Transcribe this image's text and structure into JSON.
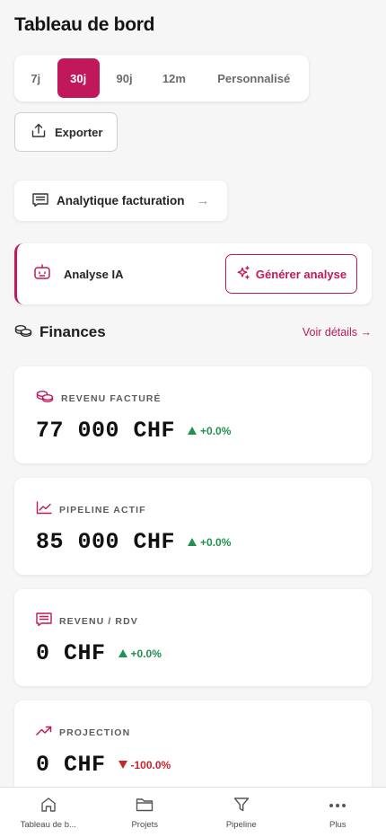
{
  "page": {
    "title": "Tableau de bord"
  },
  "range_tabs": {
    "items": [
      "7j",
      "30j",
      "90j",
      "12m",
      "Personnalisé"
    ],
    "selected": "30j"
  },
  "export": {
    "label": "Exporter"
  },
  "billing": {
    "label": "Analytique facturation",
    "arrow": "→"
  },
  "ai": {
    "label": "Analyse IA",
    "button": "Générer analyse"
  },
  "finances": {
    "title": "Finances",
    "link": "Voir détails →"
  },
  "kpis": [
    {
      "label": "REVENU FACTURÉ",
      "value": "77 000 CHF",
      "delta": "+0.0%",
      "trend": "up",
      "icon": "coins-icon"
    },
    {
      "label": "PIPELINE ACTIF",
      "value": "85 000 CHF",
      "delta": "+0.0%",
      "trend": "up",
      "icon": "trend-chart-icon"
    },
    {
      "label": "REVENU / RDV",
      "value": "0 CHF",
      "delta": "+0.0%",
      "trend": "up",
      "icon": "receipt-icon"
    },
    {
      "label": "PROJECTION",
      "value": "0 CHF",
      "delta": "-100.0%",
      "trend": "down",
      "icon": "trending-up-icon"
    }
  ],
  "nav": {
    "items": [
      {
        "label": "Tableau de b...",
        "icon": "home-icon"
      },
      {
        "label": "Projets",
        "icon": "folder-icon"
      },
      {
        "label": "Pipeline",
        "icon": "filter-icon"
      },
      {
        "label": "Plus",
        "icon": "more-icon"
      }
    ]
  },
  "colors": {
    "accent": "#c0185a",
    "positive": "#22904f",
    "negative": "#c8252c"
  }
}
